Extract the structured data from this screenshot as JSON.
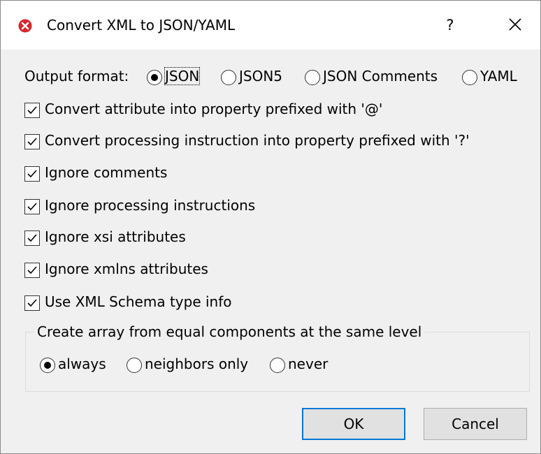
{
  "window": {
    "title": "Convert XML to JSON/YAML",
    "help_label": "?",
    "icons": {
      "app": "error-x-icon",
      "close": "close-icon"
    }
  },
  "output_format": {
    "label": "Output format:",
    "options": [
      "JSON",
      "JSON5",
      "JSON Comments",
      "YAML"
    ],
    "selected": "JSON"
  },
  "options": [
    {
      "label": "Convert attribute into property prefixed with '@'",
      "checked": true
    },
    {
      "label": "Convert processing instruction into property prefixed with '?'",
      "checked": true
    },
    {
      "label": "Ignore comments",
      "checked": true
    },
    {
      "label": "Ignore processing instructions",
      "checked": true
    },
    {
      "label": "Ignore xsi attributes",
      "checked": true
    },
    {
      "label": "Ignore xmlns attributes",
      "checked": true
    },
    {
      "label": "Use XML Schema type info",
      "checked": true
    }
  ],
  "array_group": {
    "legend": "Create array from equal components at the same level",
    "options": [
      "always",
      "neighbors only",
      "never"
    ],
    "selected": "always"
  },
  "buttons": {
    "ok": "OK",
    "cancel": "Cancel"
  },
  "colors": {
    "accent": "#0078d7",
    "app_icon_red": "#d9262c",
    "dialog_bg": "#f0f0f0"
  }
}
